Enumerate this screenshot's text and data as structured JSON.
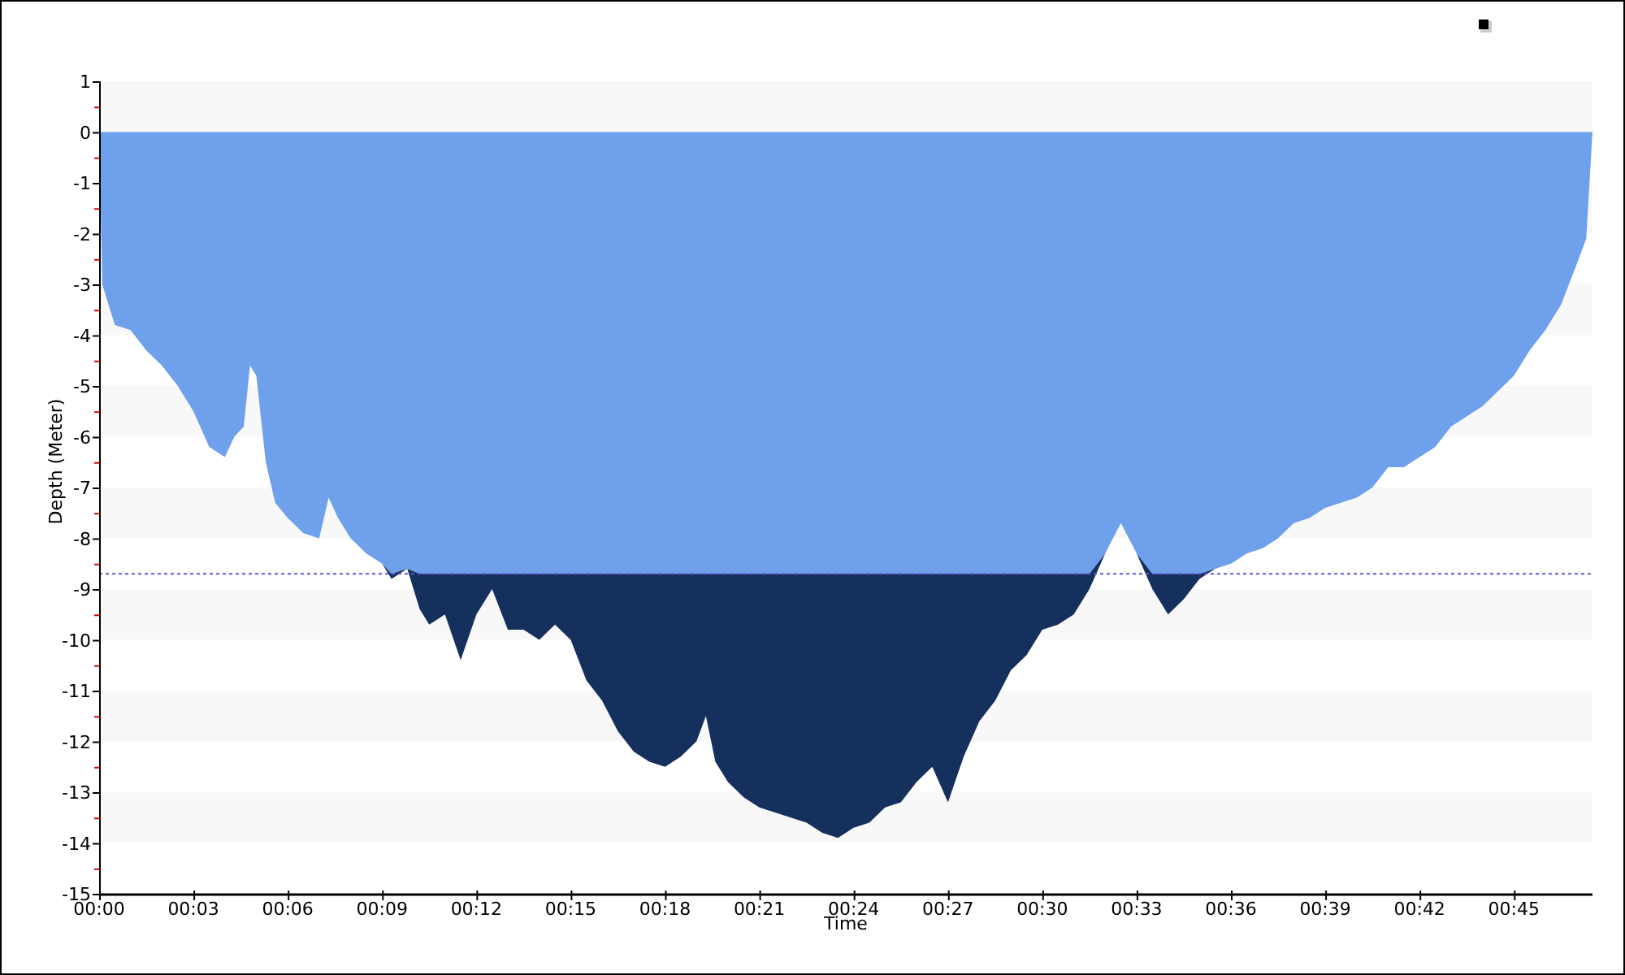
{
  "chart": {
    "chart_data": {
      "type": "area",
      "xlabel": "Time",
      "ylabel": "Depth (Meter)",
      "stacked": true,
      "x": [
        0,
        0.1,
        0.5,
        1,
        1.5,
        2,
        2.5,
        3,
        3.5,
        4,
        4.3,
        4.6,
        4.8,
        5,
        5.3,
        5.6,
        6,
        6.5,
        7,
        7.3,
        7.6,
        8,
        8.5,
        9,
        9.3,
        9.8,
        10.2,
        10.5,
        11,
        11.5,
        12,
        12.5,
        13,
        13.5,
        14,
        14.5,
        15,
        15.5,
        16,
        16.5,
        17,
        17.5,
        18,
        18.5,
        19,
        19.3,
        19.6,
        20,
        20.5,
        21,
        21.5,
        22,
        22.5,
        23,
        23.5,
        24,
        24.5,
        25,
        25.5,
        26,
        26.5,
        27,
        27.5,
        28,
        28.5,
        29,
        29.5,
        30,
        30.5,
        31,
        31.5,
        32,
        32.5,
        33,
        33.5,
        34,
        34.5,
        35,
        35.5,
        36,
        36.5,
        37,
        37.5,
        38,
        38.5,
        39,
        39.5,
        40,
        40.5,
        41,
        41.5,
        42,
        42.5,
        43,
        43.5,
        44,
        44.5,
        45,
        45.5,
        46,
        46.5,
        47,
        47.3,
        47.5
      ],
      "series": [
        {
          "color": "#6fa0ec",
          "values": [
            0,
            -3,
            -3.8,
            -3.9,
            -4.3,
            -4.6,
            -5,
            -5.5,
            -6.2,
            -6.4,
            -6,
            -5.8,
            -4.6,
            -4.8,
            -6.5,
            -7.3,
            -7.6,
            -7.9,
            -8,
            -7.2,
            -7.6,
            -8,
            -8.3,
            -8.5,
            -8.7,
            -8.6,
            -8.7,
            -8.7,
            -8.7,
            -8.7,
            -8.7,
            -8.7,
            -8.7,
            -8.7,
            -8.7,
            -8.7,
            -8.7,
            -8.7,
            -8.7,
            -8.7,
            -8.7,
            -8.7,
            -8.7,
            -8.7,
            -8.7,
            -8.7,
            -8.7,
            -8.7,
            -8.7,
            -8.7,
            -8.7,
            -8.7,
            -8.7,
            -8.7,
            -8.7,
            -8.7,
            -8.7,
            -8.7,
            -8.7,
            -8.7,
            -8.7,
            -8.7,
            -8.7,
            -8.7,
            -8.7,
            -8.7,
            -8.7,
            -8.7,
            -8.7,
            -8.7,
            -8.7,
            -8.3,
            -7.7,
            -8.3,
            -8.7,
            -8.7,
            -8.7,
            -8.7,
            -8.6,
            -8.5,
            -8.3,
            -8.2,
            -8,
            -7.7,
            -7.6,
            -7.4,
            -7.3,
            -7.2,
            -7,
            -6.6,
            -6.6,
            -6.4,
            -6.2,
            -5.8,
            -5.6,
            -5.4,
            -5.1,
            -4.8,
            -4.3,
            -3.9,
            -3.4,
            -2.6,
            -2.1,
            0
          ]
        },
        {
          "color": "#16305e",
          "values": [
            0,
            0,
            0,
            0,
            0,
            0,
            0,
            0,
            0,
            0,
            0,
            0,
            0,
            0,
            0,
            0,
            0,
            0,
            0,
            0,
            0,
            0,
            0,
            0,
            -0.1,
            0,
            -0.7,
            -1,
            -0.8,
            -1.7,
            -0.8,
            -0.3,
            -1.1,
            -1.1,
            -1.3,
            -1,
            -1.3,
            -2.1,
            -2.5,
            -3.1,
            -3.5,
            -3.7,
            -3.8,
            -3.6,
            -3.3,
            -2.8,
            -3.7,
            -4.1,
            -4.4,
            -4.6,
            -4.7,
            -4.8,
            -4.9,
            -5.1,
            -5.2,
            -5,
            -4.9,
            -4.6,
            -4.5,
            -4.1,
            -3.8,
            -4.5,
            -3.6,
            -2.9,
            -2.5,
            -1.9,
            -1.6,
            -1.1,
            -1,
            -0.8,
            -0.3,
            0,
            0,
            0,
            -0.3,
            -0.8,
            -0.5,
            -0.1,
            0,
            0,
            0,
            0,
            0,
            0,
            0,
            0,
            0,
            0,
            0,
            0,
            0,
            0,
            0,
            0,
            0,
            0,
            0,
            0,
            0,
            0,
            0,
            0,
            0,
            0
          ]
        },
        {
          "type": "line",
          "line_style": "dashed",
          "color": "#5a5ad8",
          "values": [
            -8.7,
            -8.7,
            -8.7,
            -8.7,
            -8.7,
            -8.7,
            -8.7,
            -8.7,
            -8.7,
            -8.7,
            -8.7,
            -8.7,
            -8.7,
            -8.7,
            -8.7,
            -8.7,
            -8.7,
            -8.7,
            -8.7,
            -8.7,
            -8.7,
            -8.7,
            -8.7,
            -8.7,
            -8.7,
            -8.7,
            -8.7,
            -8.7,
            -8.7,
            -8.7,
            -8.7,
            -8.7,
            -8.7,
            -8.7,
            -8.7,
            -8.7,
            -8.7,
            -8.7,
            -8.7,
            -8.7,
            -8.7,
            -8.7,
            -8.7,
            -8.7,
            -8.7,
            -8.7,
            -8.7,
            -8.7,
            -8.7,
            -8.7,
            -8.7,
            -8.7,
            -8.7,
            -8.7,
            -8.7,
            -8.7,
            -8.7,
            -8.7,
            -8.7,
            -8.7,
            -8.7,
            -8.7,
            -8.7,
            -8.7,
            -8.7,
            -8.7,
            -8.7,
            -8.7,
            -8.7,
            -8.7,
            -8.7,
            -8.7,
            -8.7,
            -8.7,
            -8.7,
            -8.7,
            -8.7,
            -8.7,
            -8.7,
            -8.7,
            -8.7,
            -8.7,
            -8.7,
            -8.7,
            -8.7,
            -8.7,
            -8.7,
            -8.7,
            -8.7,
            -8.7,
            -8.7,
            -8.7,
            -8.7,
            -8.7,
            -8.7,
            -8.7,
            -8.7,
            -8.7,
            -8.7,
            -8.7,
            -8.7,
            -8.7,
            -8.7,
            -8.7
          ]
        }
      ],
      "xlim": [
        0,
        47.5
      ],
      "ylim": [
        -15,
        1
      ],
      "xticks": [
        {
          "value": 0,
          "label": "00:00"
        },
        {
          "value": 3,
          "label": "00:03"
        },
        {
          "value": 6,
          "label": "00:06"
        },
        {
          "value": 9,
          "label": "00:09"
        },
        {
          "value": 12,
          "label": "00:12"
        },
        {
          "value": 15,
          "label": "00:15"
        },
        {
          "value": 18,
          "label": "00:18"
        },
        {
          "value": 21,
          "label": "00:21"
        },
        {
          "value": 24,
          "label": "00:24"
        },
        {
          "value": 27,
          "label": "00:27"
        },
        {
          "value": 30,
          "label": "00:30"
        },
        {
          "value": 33,
          "label": "00:33"
        },
        {
          "value": 36,
          "label": "00:36"
        },
        {
          "value": 39,
          "label": "00:39"
        },
        {
          "value": 42,
          "label": "00:42"
        },
        {
          "value": 45,
          "label": "00:45"
        }
      ],
      "yticks": [
        1,
        0,
        -1,
        -2,
        -3,
        -4,
        -5,
        -6,
        -7,
        -8,
        -9,
        -10,
        -11,
        -12,
        -13,
        -14,
        -15
      ]
    }
  }
}
